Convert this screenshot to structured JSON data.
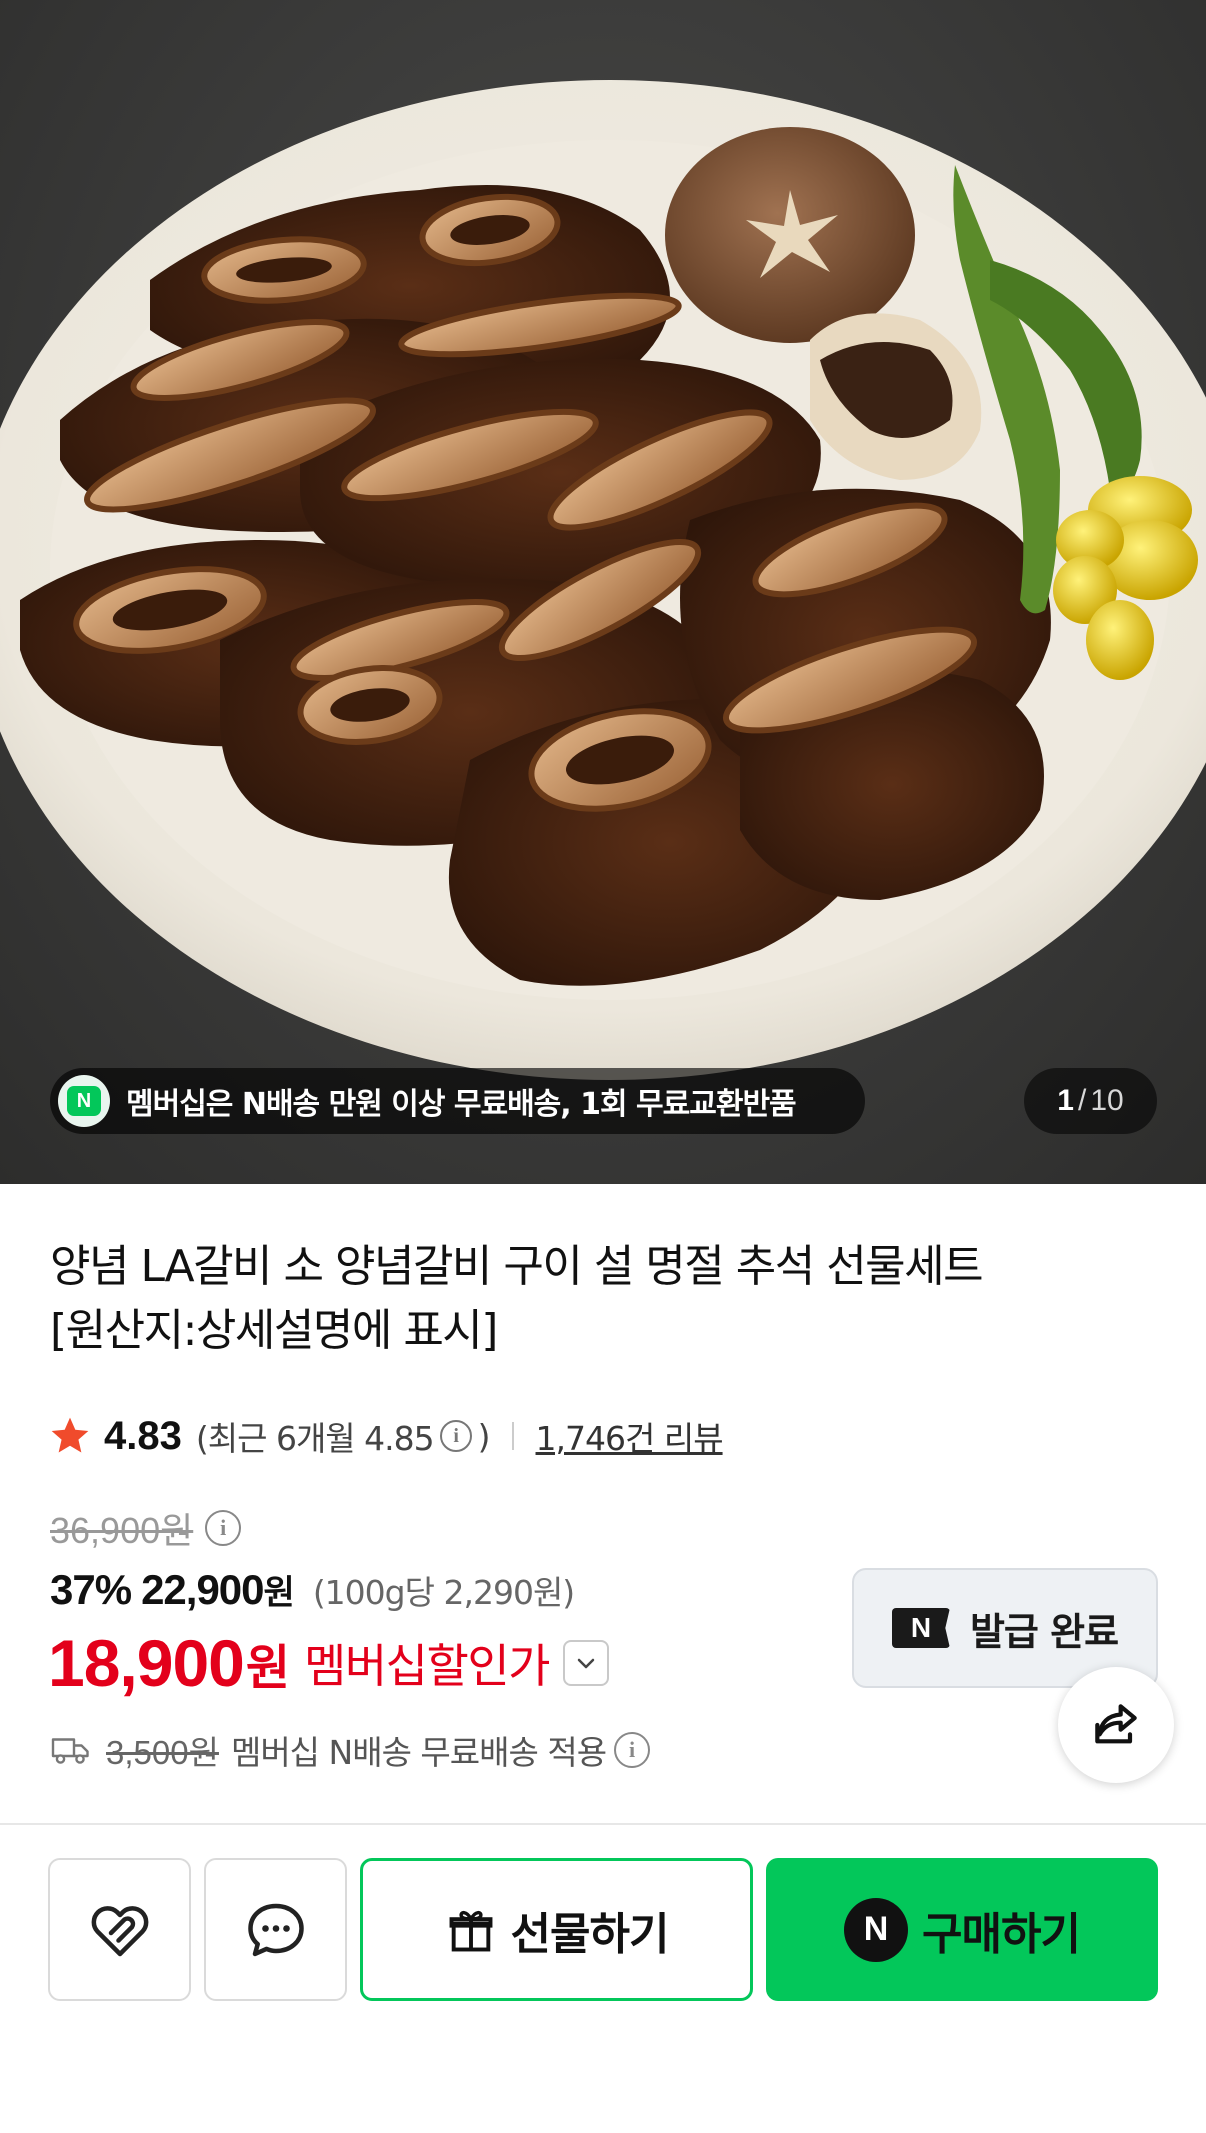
{
  "hero": {
    "promo_badge": "N",
    "promo_text": "멤버십은 N배송 만원 이상 무료배송, 1회 무료교환반품",
    "counter_current": "1",
    "counter_separator": "/",
    "counter_total": "10"
  },
  "product": {
    "title_line1": "양념 LA갈비 소 양념갈비 구이 설 명절 추석 선물세트",
    "title_line2": "[원산지:상세설명에 표시]",
    "rating": "4.83",
    "recent_rating_open": "(최근 6개월 4.85",
    "recent_rating_close": ")",
    "review_link": "1,746건 리뷰"
  },
  "price": {
    "original": "36,900원",
    "discount_rate": "37%",
    "sale_price": "22,900",
    "sale_unit": "원",
    "per_unit": "(100g당 2,290원)",
    "member_price": "18,900",
    "member_unit": "원",
    "member_label": "멤버십할인가"
  },
  "coupon": {
    "badge": "N",
    "label": "발급 완료"
  },
  "shipping": {
    "fee": "3,500원",
    "text": "멤버십 N배송 무료배송 적용"
  },
  "actions": {
    "gift_label": "선물하기",
    "buy_badge": "N",
    "buy_label": "구매하기"
  },
  "colors": {
    "naver_green": "#03c75a",
    "member_red": "#e3001b"
  },
  "icons": {
    "wishlist": "heart-link-icon",
    "talk": "chat-bubble-icon",
    "gift": "gift-box-icon",
    "share": "share-icon",
    "truck": "truck-icon",
    "info": "info-icon",
    "star": "star-icon",
    "chevron": "chevron-down-icon"
  }
}
